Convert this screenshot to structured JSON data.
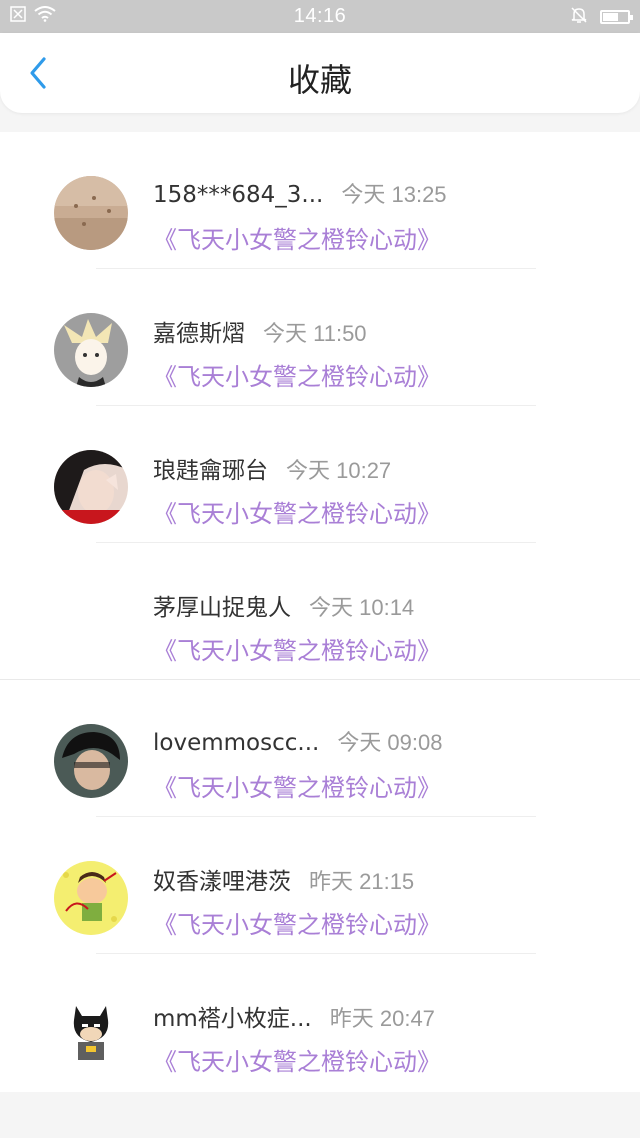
{
  "status_bar": {
    "time": "14:16"
  },
  "nav": {
    "title": "收藏"
  },
  "colors": {
    "accent_blue": "#2f9bea",
    "work_title_purple": "#a97fd6"
  },
  "favorites": [
    {
      "username": "158***684_3...",
      "time": "今天 13:25",
      "work": "《飞天小女警之橙铃心动》",
      "avatar": "sand-texture-avatar"
    },
    {
      "username": "嘉德斯熠",
      "time": "今天 11:50",
      "work": "《飞天小女警之橙铃心动》",
      "avatar": "anime-character-avatar"
    },
    {
      "username": "琅韪龠琊台",
      "time": "今天 10:27",
      "work": "《飞天小女警之橙铃心动》",
      "avatar": "girl-photo-avatar"
    },
    {
      "username": "茅厚山捉鬼人",
      "time": "今天 10:14",
      "work": "《飞天小女警之橙铃心动》",
      "avatar": ""
    },
    {
      "username": "lovemmoscc...",
      "time": "今天 09:08",
      "work": "《飞天小女警之橙铃心动》",
      "avatar": "boy-photo-avatar"
    },
    {
      "username": "奴香漾哩港茨",
      "time": "昨天 21:15",
      "work": "《飞天小女警之橙铃心动》",
      "avatar": "cartoon-archer-avatar"
    },
    {
      "username": "mm褡小枚症...",
      "time": "昨天 20:47",
      "work": "《飞天小女警之橙铃心动》",
      "avatar": "batman-cartoon-avatar"
    }
  ]
}
